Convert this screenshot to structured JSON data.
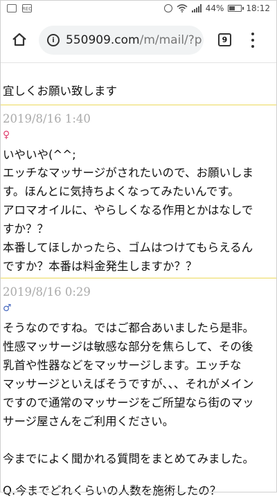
{
  "status_bar": {
    "battery": "44%",
    "time": "18:12",
    "icons": [
      "image-icon",
      "rec-icon",
      "alarm-icon",
      "wifi-icon",
      "signal-icon",
      "battery-icon"
    ],
    "rec_label": "REC"
  },
  "browser": {
    "url_domain": "550909.com",
    "url_path": "/m/mail/?p",
    "tab_count": "9"
  },
  "messages": [
    {
      "lines": [
        "宜しくお願い致します"
      ]
    },
    {
      "date": "2019/8/16 1:40",
      "gender_symbol": "♀",
      "lines": [
        "いやいや(^^;",
        "エッチなマッサージがされたいので、お願いしま",
        "す。ほんとに気持ちよくなってみたいんです。",
        "アロマオイルに、やらしくなる作用とかはなしで",
        "すか？？",
        "本番してほしかったら、ゴムはつけてもらえるん",
        "ですか？本番は料金発生しますか？？"
      ]
    },
    {
      "date": "2019/8/16 0:29",
      "gender_symbol": "♂",
      "lines": [
        "そうなのですね。ではご都合あいましたら是非。",
        "性感マッサージは敏感な部分を焦らして、その後",
        "乳首や性器などをマッサージします。エッチな",
        "マッサージといえばそうですが、、、それがメイン",
        "ですので通常のマッサージをご所望なら街のマッ",
        "サージ屋さんをご利用ください。",
        "",
        "今までによく聞かれる質問をまとめてみました。",
        "",
        "Q.今までどれくらいの人数を施術したの？"
      ]
    }
  ]
}
